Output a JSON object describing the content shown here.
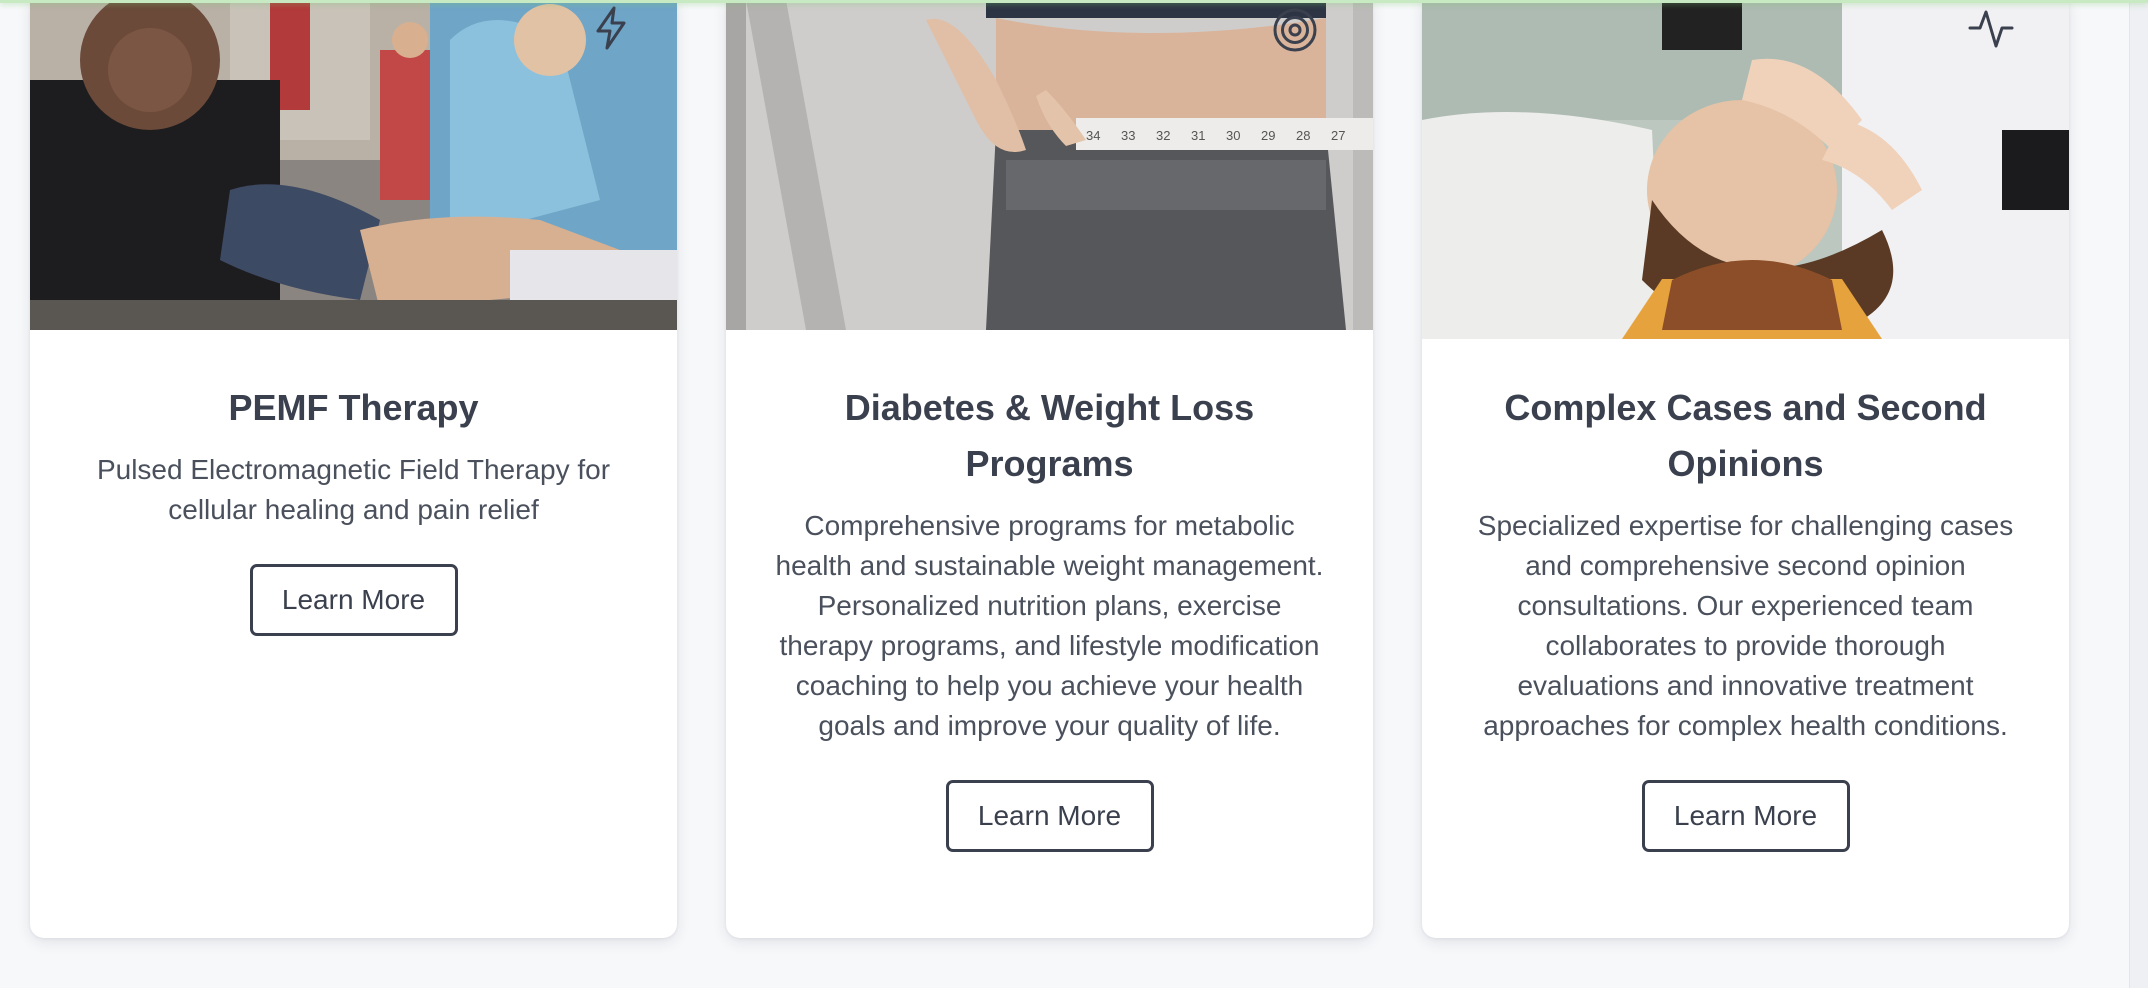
{
  "cards": [
    {
      "title": "PEMF Therapy",
      "description": "Pulsed Electromagnetic Field Therapy for cellular healing and pain relief",
      "button_label": "Learn More",
      "icon": "lightning-icon",
      "image": "blood-pressure-measurement-photo"
    },
    {
      "title": "Diabetes & Weight Loss Programs",
      "description": "Comprehensive programs for metabolic health and sustainable weight management. Personalized nutrition plans, exercise therapy programs, and lifestyle modification coaching to help you achieve your health goals and improve your quality of life.",
      "button_label": "Learn More",
      "icon": "target-icon",
      "image": "waist-measuring-tape-photo",
      "tape_numbers": [
        "34",
        "33",
        "32",
        "31",
        "30",
        "29",
        "28",
        "27"
      ]
    },
    {
      "title": "Complex Cases and Second Opinions",
      "description": "Specialized expertise for challenging cases and comprehensive second opinion consultations. Our experienced team collaborates to provide thorough evaluations and innovative treatment approaches for complex health conditions.",
      "button_label": "Learn More",
      "icon": "pulse-icon",
      "image": "head-massage-therapy-photo"
    }
  ],
  "colors": {
    "background": "#f7f8fa",
    "card": "#ffffff",
    "text": "#3a404d",
    "accent_line": "#c8eac2"
  }
}
